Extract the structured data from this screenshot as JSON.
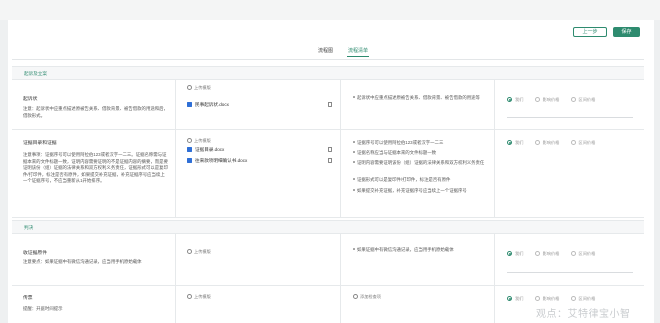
{
  "header": {
    "prev_label": "上一步",
    "save_label": "保存"
  },
  "tabs": [
    {
      "label": "流程图",
      "active": false
    },
    {
      "label": "流程清单",
      "active": true
    }
  ],
  "sections": [
    {
      "title": "起诉及立案"
    },
    {
      "title": "判决"
    }
  ],
  "rows": [
    {
      "title": "起诉状",
      "note": "注意：起诉状中应重点描述原被告关系、借款背景、被告借款的用途和后，借款形式。",
      "upload_label": "上传模版",
      "files": [
        "民事起诉状.docx"
      ],
      "requirements": [
        "起诉状中应重点描述原被告关系、借款背景、被告借款的用途等"
      ],
      "radios": [
        "我们",
        "影响价格",
        "区间价格"
      ],
      "radio_selected": 0
    },
    {
      "title": "证据目录和证据",
      "note": "注意事项：证据序号可以使用阿拉伯123或者汉字一二三。证据名称需与证据本来的文件标题一致，证明内容需要证明的不是证据内容的摘要，而是要证明该份（组）证据的法律关系和双方权利义务责任，证据形式可以是复印件/打印件，标注是否有原件，如果提交补充证据，补充证据序号应当续上一个证据序号，不应当重新从1开始排序。",
      "upload_label": "上传模版",
      "files": [
        "证据目录.docx",
        "往来款项明细确认书.docx"
      ],
      "requirements": [
        "证据序号可以使用阿拉伯123或者汉字一二三",
        "证据名称应当与证据本来的文件标题一致",
        "证明内容需要证明该份（组）证据的法律关系和双方权利义务责任",
        "证据形式可以是复印件/打印件，标注是否有原件",
        "如果提交补充证据，补充证据序号应当续上一个证据序号"
      ],
      "radios": [
        "我们",
        "影响价格",
        "区间价格"
      ],
      "radio_selected": 0
    },
    {
      "title": "收证据原件",
      "note": "注意要点：如果证据中有微信沟通记录，应当用手机原始载体",
      "upload_label": "上传模版",
      "files": [],
      "requirements": [
        "如果证据中有微信沟通记录，应当用手机原始载体"
      ],
      "radios": [
        "我们",
        "影响价格",
        "区间价格"
      ],
      "radio_selected": 0
    },
    {
      "title": "传票",
      "note": "提醒：开庭时间提示",
      "upload_label": "上传模版",
      "files": [],
      "requirements_label": "添加检查项",
      "radios": [
        "我们",
        "影响价格",
        "区间价格"
      ],
      "radio_selected": 0
    }
  ],
  "watermark": "观点：艾特律宝小智"
}
